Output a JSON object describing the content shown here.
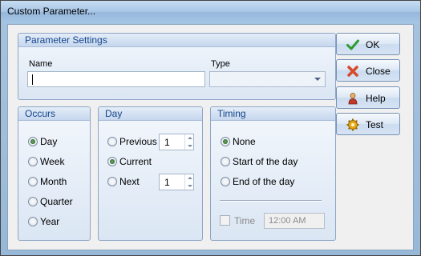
{
  "window": {
    "title": "Custom Parameter..."
  },
  "parameter_settings": {
    "header": "Parameter Settings",
    "name_label": "Name",
    "name_value": "",
    "type_label": "Type",
    "type_value": ""
  },
  "occurs": {
    "header": "Occurs",
    "options": [
      {
        "label": "Day",
        "selected": true
      },
      {
        "label": "Week",
        "selected": false
      },
      {
        "label": "Month",
        "selected": false
      },
      {
        "label": "Quarter",
        "selected": false
      },
      {
        "label": "Year",
        "selected": false
      }
    ]
  },
  "day": {
    "header": "Day",
    "previous_label": "Previous",
    "previous_value": "1",
    "current_label": "Current",
    "next_label": "Next",
    "next_value": "1",
    "selected": "Current"
  },
  "timing": {
    "header": "Timing",
    "options": [
      {
        "label": "None",
        "selected": true
      },
      {
        "label": "Start of the day",
        "selected": false
      },
      {
        "label": "End of the day",
        "selected": false
      }
    ],
    "time_label": "Time",
    "time_value": "12:00 AM"
  },
  "buttons": {
    "ok": {
      "label": "OK",
      "icon": "checkmark-icon",
      "color": "#2f9a2f"
    },
    "close": {
      "label": "Close",
      "icon": "close-icon",
      "color": "#d64a2a"
    },
    "help": {
      "label": "Help",
      "icon": "help-person-icon",
      "color": "#c0392b"
    },
    "test": {
      "label": "Test",
      "icon": "gear-icon",
      "color": "#e6a817"
    }
  }
}
